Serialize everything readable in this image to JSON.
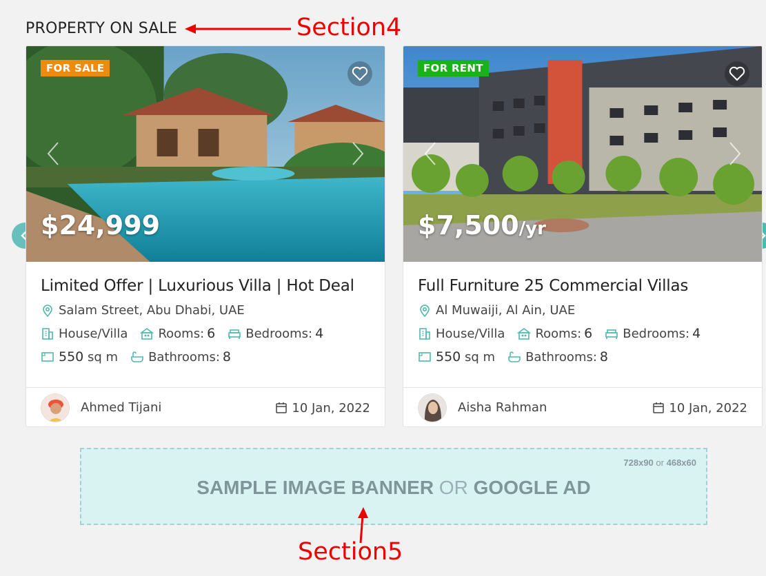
{
  "section": {
    "title": "PROPERTY ON SALE"
  },
  "annotations": {
    "section4": "Section4",
    "section5": "Section5"
  },
  "colors": {
    "accent": "#4fb8b0",
    "sale_badge": "#f08a0a",
    "rent_badge": "#1ab21a",
    "annotation": "#ee0000",
    "banner_bg": "#d9f3f3"
  },
  "listings": [
    {
      "badge": "FOR SALE",
      "price": "$24,999",
      "price_unit": "",
      "title": "Limited Offer | Luxurious Villa | Hot Deal",
      "location": "Salam Street, Abu Dhabi, UAE",
      "type": "House/Villa",
      "rooms_label": "Rooms:",
      "rooms": "6",
      "bedrooms_label": "Bedrooms:",
      "bedrooms": "4",
      "area": "550",
      "area_unit": "sq m",
      "bathrooms_label": "Bathrooms:",
      "bathrooms": "8",
      "agent": "Ahmed Tijani",
      "date": "10 Jan, 2022"
    },
    {
      "badge": "FOR RENT",
      "price": "$7,500",
      "price_unit": "/yr",
      "title": "Full Furniture 25 Commercial Villas",
      "location": "Al Muwaiji, Al Ain, UAE",
      "type": "House/Villa",
      "rooms_label": "Rooms:",
      "rooms": "6",
      "bedrooms_label": "Bedrooms:",
      "bedrooms": "4",
      "area": "550",
      "area_unit": "sq m",
      "bathrooms_label": "Bathrooms:",
      "bathrooms": "8",
      "agent": "Aisha Rahman",
      "date": "10 Jan, 2022"
    }
  ],
  "banner": {
    "size_a": "728x90",
    "size_or": "or",
    "size_b": "468x60",
    "text_a": "SAMPLE IMAGE BANNER",
    "text_or": "OR",
    "text_b": "GOOGLE AD"
  },
  "icons": {
    "favorite": "heart-icon",
    "prev": "chevron-left-icon",
    "next": "chevron-right-icon",
    "location": "map-pin-icon",
    "type": "building-icon",
    "rooms": "rooms-icon",
    "bedrooms": "bed-icon",
    "area": "area-icon",
    "bathrooms": "bathtub-icon",
    "date": "calendar-icon"
  }
}
